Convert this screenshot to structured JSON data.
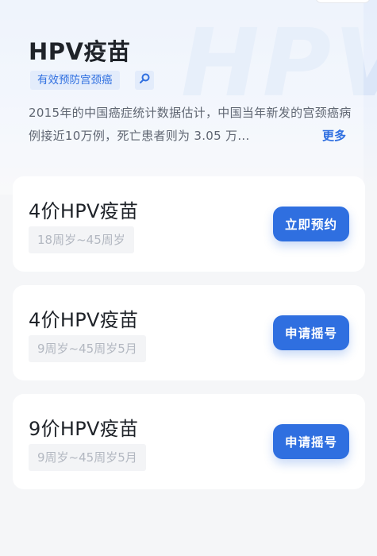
{
  "hero": {
    "watermark": "HPV",
    "title": "HPV疫苗",
    "tag": "有效预防宫颈癌",
    "tag_icon": "search-icon",
    "description": "2015年的中国癌症统计数据估计，中国当年新发的宫颈癌病例接近10万例，死亡患者则为 3.05 万...",
    "more_label": "更多",
    "accent_color": "#2f6fe0"
  },
  "vaccines": [
    {
      "name": "4价HPV疫苗",
      "age_range": "18周岁~45周岁",
      "action_label": "立即预约"
    },
    {
      "name": "4价HPV疫苗",
      "age_range": "9周岁~45周岁5月",
      "action_label": "申请摇号"
    },
    {
      "name": "9价HPV疫苗",
      "age_range": "9周岁~45周岁5月",
      "action_label": "申请摇号"
    }
  ]
}
